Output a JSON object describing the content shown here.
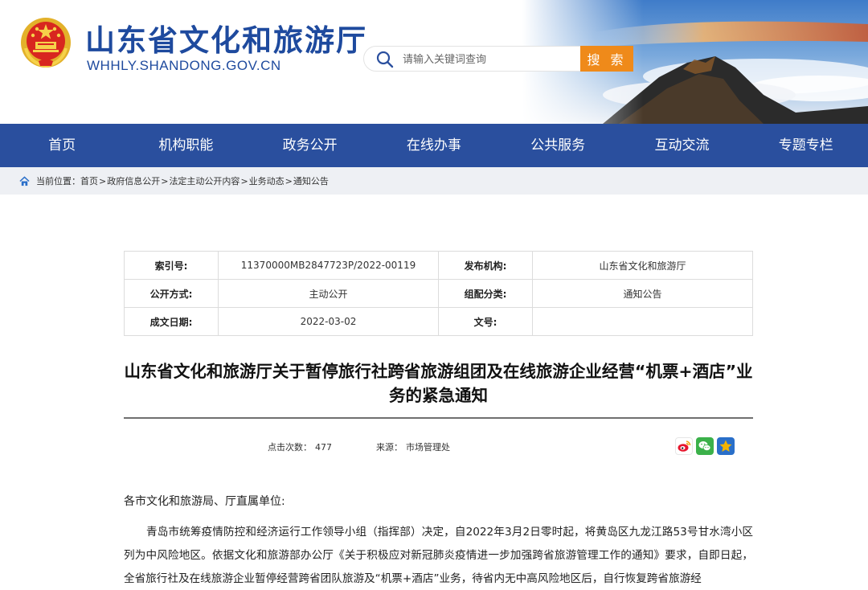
{
  "header": {
    "site_title": "山东省文化和旅游厅",
    "site_domain": "WHHLY.SHANDONG.GOV.CN",
    "search_placeholder": "请输入关键词查询",
    "search_button": "搜 索"
  },
  "nav": {
    "items": [
      "首页",
      "机构职能",
      "政务公开",
      "在线办事",
      "公共服务",
      "互动交流",
      "专题专栏"
    ]
  },
  "breadcrumb": {
    "label": "当前位置：",
    "items": [
      "首页",
      "政府信息公开",
      "法定主动公开内容",
      "业务动态",
      "通知公告"
    ],
    "separator": ">"
  },
  "meta": {
    "index_label": "索引号:",
    "index_value": "11370000MB2847723P/2022-00119",
    "publisher_label": "发布机构:",
    "publisher_value": "山东省文化和旅游厅",
    "open_label": "公开方式:",
    "open_value": "主动公开",
    "category_label": "组配分类:",
    "category_value": "通知公告",
    "date_label": "成文日期:",
    "date_value": "2022-03-02",
    "docno_label": "文号:",
    "docno_value": ""
  },
  "article": {
    "title": "山东省文化和旅游厅关于暂停旅行社跨省旅游组团及在线旅游企业经营“机票+酒店”业务的紧急通知",
    "views_label": "点击次数：",
    "views_value": "477",
    "source_label": "来源：",
    "source_value": "市场管理处",
    "salutation": "各市文化和旅游局、厅直属单位:",
    "paragraph": "青岛市统筹疫情防控和经济运行工作领导小组（指挥部）决定，自2022年3月2日零时起，将黄岛区九龙江路53号甘水湾小区列为中风险地区。依据文化和旅游部办公厅《关于积极应对新冠肺炎疫情进一步加强跨省旅游管理工作的通知》要求，自即日起，全省旅行社及在线旅游企业暂停经营跨省团队旅游及“机票+酒店”业务，待省内无中高风险地区后，自行恢复跨省旅游经"
  },
  "share": {
    "icons": [
      "weibo-icon",
      "wechat-icon",
      "favorite-star-icon"
    ],
    "colors": {
      "weibo": "#e6162d",
      "wechat": "#3bb14a",
      "favorite": "#f3b400"
    }
  },
  "colors": {
    "brand_blue": "#2a4f9e",
    "title_blue": "#1e4a9e",
    "accent_orange": "#ef8a1a",
    "breadcrumb_bg": "#eef0f4"
  }
}
